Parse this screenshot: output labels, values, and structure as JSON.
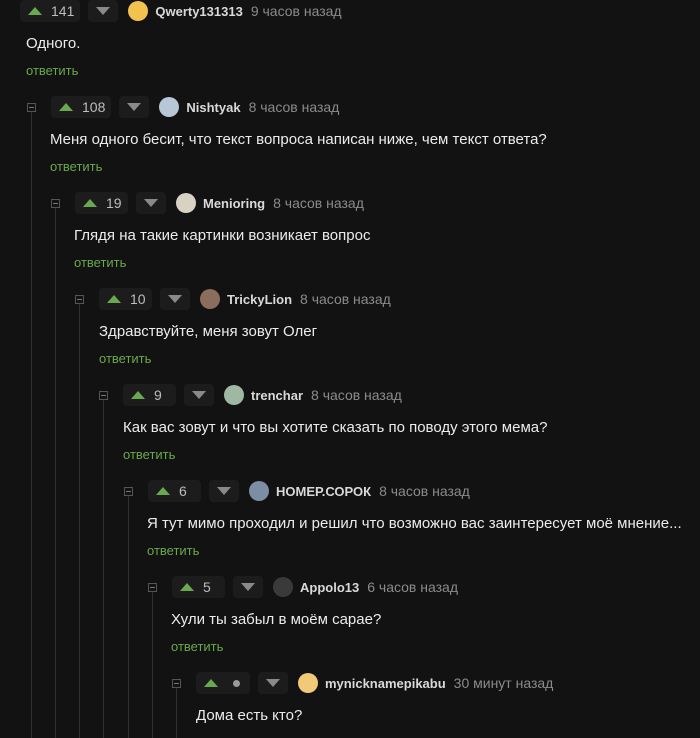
{
  "reply_label": "ответить",
  "comments": [
    {
      "rating": "141",
      "nick": "Qwerty131313",
      "time": "9 часов назад",
      "text": "Одного.",
      "avatar_color": "#f2c14e"
    },
    {
      "rating": "108",
      "nick": "Nishtyak",
      "time": "8 часов назад",
      "text": "Меня одного бесит, что текст вопроса написан ниже, чем текст ответа?",
      "avatar_color": "#b8c7d6"
    },
    {
      "rating": "19",
      "nick": "Menioring",
      "time": "8 часов назад",
      "text": "Глядя на такие картинки возникает вопрос",
      "avatar_color": "#d8d2c4"
    },
    {
      "rating": "10",
      "nick": "TrickyLion",
      "time": "8 часов назад",
      "text": "Здравствуйте, меня зовут Олег",
      "avatar_color": "#8a6d5c"
    },
    {
      "rating": "9",
      "nick": "trenchar",
      "time": "8 часов назад",
      "text": "Как вас зовут и что вы хотите сказать по поводу этого мема?",
      "avatar_color": "#9fb8a3"
    },
    {
      "rating": "6",
      "nick": "НОМЕР.СОРОК",
      "time": "8 часов назад",
      "text": "Я тут мимо проходил и решил что возможно вас заинтересует моё мнение...",
      "avatar_color": "#7c8ea3"
    },
    {
      "rating": "5",
      "nick": "Appolo13",
      "time": "6 часов назад",
      "text": "Хули ты забыл в моём сарае?",
      "avatar_color": "#3a3a3a"
    },
    {
      "rating": "",
      "nick": "mynicknamepikabu",
      "time": "30 минут назад",
      "text": "Дома есть кто?",
      "avatar_color": "#f2c879"
    }
  ],
  "colors": {
    "upvote": "#6aa84f",
    "reply": "#6aa84f",
    "background": "#121212"
  },
  "icons": {
    "up": "upvote-arrow-icon",
    "down": "downvote-arrow-icon",
    "collapse": "collapse-icon",
    "pending": "rating-hidden-dot-icon"
  }
}
